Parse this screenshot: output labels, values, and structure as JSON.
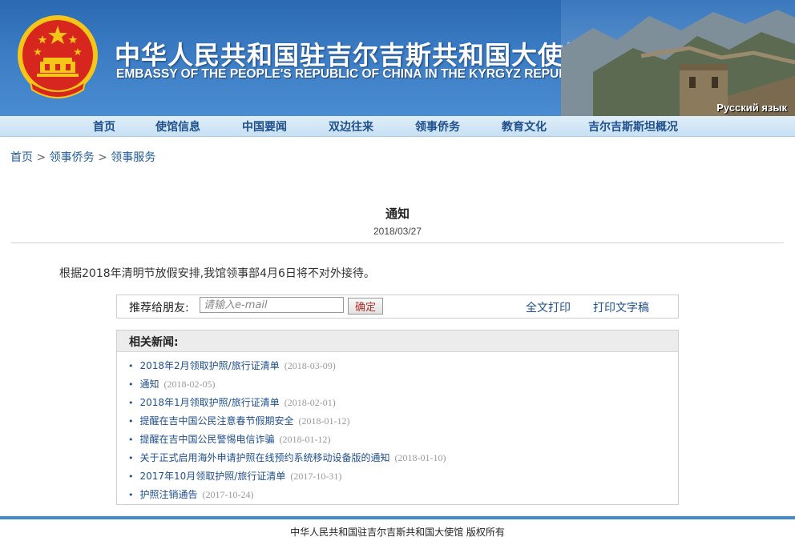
{
  "header": {
    "title_cn": "中华人民共和国驻吉尔吉斯共和国大使馆",
    "title_en": "EMBASSY OF THE PEOPLE'S REPUBLIC OF CHINA IN THE KYRGYZ REPUBLIC",
    "language_link": "Русский язык",
    "emblem_icon": "national-emblem-icon",
    "colors": {
      "banner": "#2b6ab3",
      "emblem_red": "#d7261e",
      "emblem_gold": "#f5c518"
    }
  },
  "nav": {
    "items": [
      "首页",
      "使馆信息",
      "中国要闻",
      "双边往来",
      "领事侨务",
      "教育文化",
      "吉尔吉斯斯坦概况"
    ]
  },
  "breadcrumb": {
    "home": "首页",
    "section": "领事侨务",
    "current": "领事服务",
    "separator": ">"
  },
  "article": {
    "title": "通知",
    "date": "2018/03/27",
    "body": "根据2018年清明节放假安排,我馆领事部4月6日将不对外接待。"
  },
  "share": {
    "label": "推荐给朋友:",
    "placeholder": "请输入e-mail",
    "submit": "确定",
    "print_all": "全文打印",
    "print_text": "打印文字稿"
  },
  "related": {
    "title": "相关新闻:",
    "items": [
      {
        "title": "2018年2月领取护照/旅行证清单",
        "date": "(2018-03-09)"
      },
      {
        "title": "通知",
        "date": "(2018-02-05)"
      },
      {
        "title": "2018年1月领取护照/旅行证清单",
        "date": "(2018-02-01)"
      },
      {
        "title": "提醒在吉中国公民注意春节假期安全",
        "date": "(2018-01-12)"
      },
      {
        "title": "提醒在吉中国公民警惕电信诈骗",
        "date": "(2018-01-12)"
      },
      {
        "title": "关于正式启用海外申请护照在线预约系统移动设备版的通知",
        "date": "(2018-01-10)"
      },
      {
        "title": "2017年10月领取护照/旅行证清单",
        "date": "(2017-10-31)"
      },
      {
        "title": "护照注销通告",
        "date": "(2017-10-24)"
      }
    ]
  },
  "footer": {
    "copyright": "中华人民共和国驻吉尔吉斯共和国大使馆 版权所有"
  }
}
